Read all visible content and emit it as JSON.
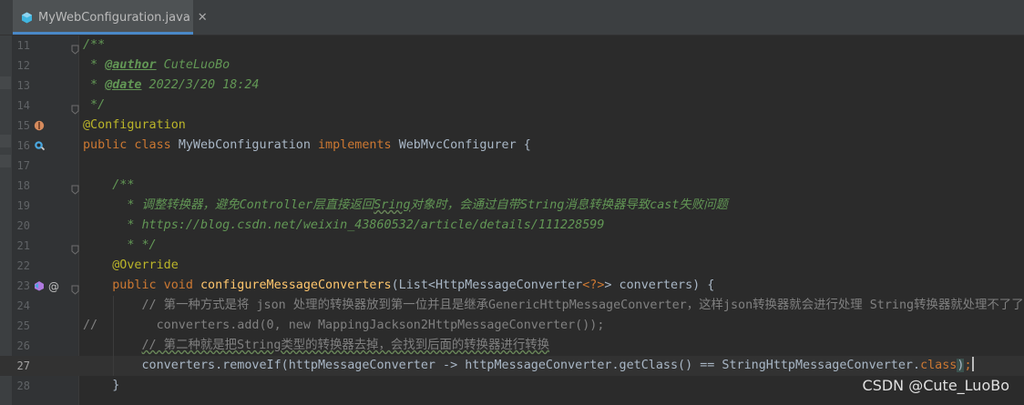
{
  "tab": {
    "file_icon": "java-class-icon",
    "filename": "MyWebConfiguration.java",
    "close_label": "✕"
  },
  "editor": {
    "current_line": 27,
    "lines": [
      {
        "num": "11",
        "parts": [
          [
            "cmt",
            "/**"
          ]
        ]
      },
      {
        "num": "12",
        "parts": [
          [
            "cmt",
            " * "
          ],
          [
            "tag",
            "@author"
          ],
          [
            "cmt",
            " CuteLuoBo"
          ]
        ]
      },
      {
        "num": "13",
        "parts": [
          [
            "cmt",
            " * "
          ],
          [
            "tag",
            "@date"
          ],
          [
            "cmt",
            " 2022/3/20 18:24"
          ]
        ]
      },
      {
        "num": "14",
        "parts": [
          [
            "cmt",
            " */"
          ]
        ]
      },
      {
        "num": "15",
        "parts": [
          [
            "ann",
            "@Configuration"
          ]
        ]
      },
      {
        "num": "16",
        "parts": [
          [
            "kw",
            "public class "
          ],
          [
            "plain",
            "MyWebConfiguration "
          ],
          [
            "kw",
            "implements "
          ],
          [
            "plain",
            "WebMvcConfigurer {"
          ]
        ]
      },
      {
        "num": "17",
        "parts": []
      },
      {
        "num": "18",
        "parts": [
          [
            "plain",
            "    "
          ],
          [
            "cmt",
            "/**"
          ]
        ]
      },
      {
        "num": "19",
        "parts": [
          [
            "plain",
            "    "
          ],
          [
            "cmt",
            "  * 调整转换器，避免Controller层直接返回"
          ],
          [
            "cmt sq",
            "Sring"
          ],
          [
            "cmt",
            "对象时，会通过自带String消息转换器导致cast失败问题"
          ]
        ]
      },
      {
        "num": "20",
        "parts": [
          [
            "plain",
            "    "
          ],
          [
            "cmt",
            "  * https://blog.csdn.net/weixin_43860532/article/details/111228599"
          ]
        ]
      },
      {
        "num": "21",
        "parts": [
          [
            "plain",
            "    "
          ],
          [
            "cmt",
            "  * */"
          ]
        ]
      },
      {
        "num": "22",
        "parts": [
          [
            "plain",
            "    "
          ],
          [
            "ann",
            "@Override"
          ]
        ]
      },
      {
        "num": "23",
        "parts": [
          [
            "plain",
            "    "
          ],
          [
            "kw",
            "public void "
          ],
          [
            "fn",
            "configureMessageConverters"
          ],
          [
            "plain",
            "(List<HttpMessageConverter"
          ],
          [
            "kw",
            "<?>"
          ],
          [
            "plain",
            "> converters) {"
          ]
        ]
      },
      {
        "num": "24",
        "parts": [
          [
            "plain",
            "        "
          ],
          [
            "lc",
            "// 第一种方式是将 json 处理的转换器放到第一位并且是继承GenericHttpMessageConverter，这样json转换器就会进行处理 String转换器就处理不了了。"
          ]
        ]
      },
      {
        "num": "25",
        "parts": [
          [
            "lc",
            "//        converters.add(0, new MappingJackson2HttpMessageConverter());"
          ]
        ]
      },
      {
        "num": "26",
        "parts": [
          [
            "plain",
            "        "
          ],
          [
            "lc sq",
            "// 第二种就是把String类型的转换器去掉，会找到后面的转换器进行转换"
          ]
        ]
      },
      {
        "num": "27",
        "parts": [
          [
            "plain",
            "        converters.removeIf(httpMessageConverter -> httpMessageConverter.getClass() == StringHttpMessageConverter."
          ],
          [
            "kw",
            "class"
          ],
          [
            "pb",
            ")"
          ],
          [
            "kw",
            ";"
          ]
        ]
      },
      {
        "num": "28",
        "parts": [
          [
            "plain",
            "    }"
          ]
        ]
      }
    ]
  },
  "gutter_icons": {
    "15": [
      "bean-config-icon"
    ],
    "16": [
      "bean-search-icon"
    ],
    "23": [
      "implement-method-icon",
      "override-at-icon"
    ]
  },
  "fold_markers": [
    "11",
    "14",
    "18",
    "21",
    "23"
  ],
  "watermark": "CSDN @Cute_LuoBo"
}
